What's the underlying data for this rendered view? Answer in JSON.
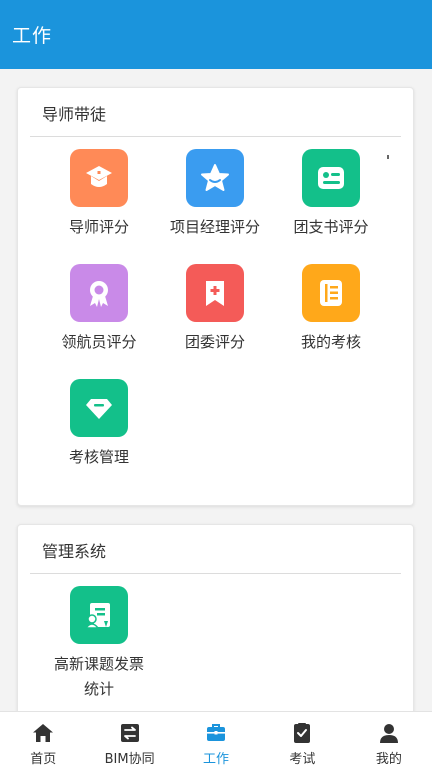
{
  "header": {
    "title": "工作"
  },
  "colors": {
    "header": "#1b94dc",
    "orange": "#ff8a57",
    "blue": "#3a9cf0",
    "green": "#13c08a",
    "purple": "#c98ae8",
    "red": "#f45b58",
    "amber": "#ffa81a",
    "active": "#1b94dc"
  },
  "sections": [
    {
      "title": "导师带徒",
      "items": [
        {
          "label": "导师评分",
          "icon": "graduation-cap-icon"
        },
        {
          "label": "项目经理评分",
          "icon": "star-icon"
        },
        {
          "label": "团支书评分",
          "icon": "id-card-icon"
        },
        {
          "label": "领航员评分",
          "icon": "award-ribbon-icon"
        },
        {
          "label": "团委评分",
          "icon": "bookmark-plus-icon"
        },
        {
          "label": "我的考核",
          "icon": "notebook-icon"
        },
        {
          "label": "考核管理",
          "icon": "diamond-icon"
        }
      ]
    },
    {
      "title": "管理系统",
      "items": [
        {
          "label": "高新课题发票统计",
          "icon": "certificate-user-icon"
        }
      ]
    }
  ],
  "nav": [
    {
      "label": "首页",
      "icon": "home-icon",
      "active": false
    },
    {
      "label": "BIM协同",
      "icon": "exchange-icon",
      "active": false
    },
    {
      "label": "工作",
      "icon": "briefcase-icon",
      "active": true
    },
    {
      "label": "考试",
      "icon": "checklist-icon",
      "active": false
    },
    {
      "label": "我的",
      "icon": "user-icon",
      "active": false
    }
  ]
}
